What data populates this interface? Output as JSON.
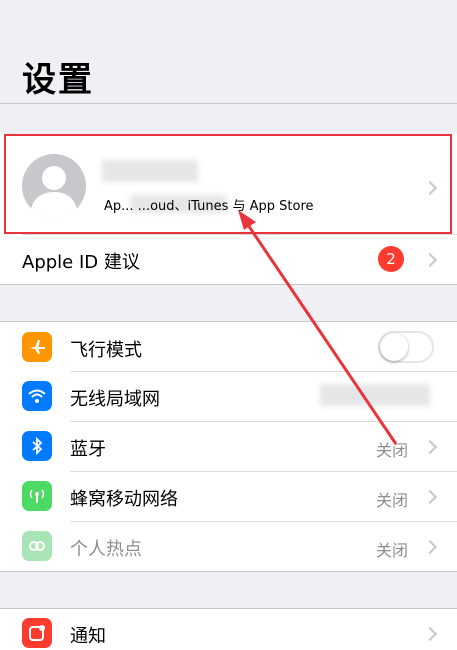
{
  "header": {
    "title": "设置"
  },
  "account": {
    "subtitle": "Ap... ...oud、iTunes 与 App Store"
  },
  "apple_id": {
    "label": "Apple ID 建议",
    "badge": "2"
  },
  "connectivity": [
    {
      "label": "飞行模式",
      "icon": "airplane-icon",
      "color": "#ff9500",
      "value": ""
    },
    {
      "label": "无线局域网",
      "icon": "wifi-icon",
      "color": "#007aff",
      "value": ""
    },
    {
      "label": "蓝牙",
      "icon": "bluetooth-icon",
      "color": "#007aff",
      "value": "关闭"
    },
    {
      "label": "蜂窝移动网络",
      "icon": "cellular-icon",
      "color": "#4cd964",
      "value": "关闭"
    },
    {
      "label": "个人热点",
      "icon": "hotspot-icon",
      "color": "#a8e4b5",
      "value": "关闭"
    }
  ],
  "notifications": {
    "label": "通知",
    "icon": "notification-icon",
    "color": "#ff3b30"
  },
  "colors": {
    "highlight": "#e8353b",
    "badge": "#ff3b30"
  }
}
